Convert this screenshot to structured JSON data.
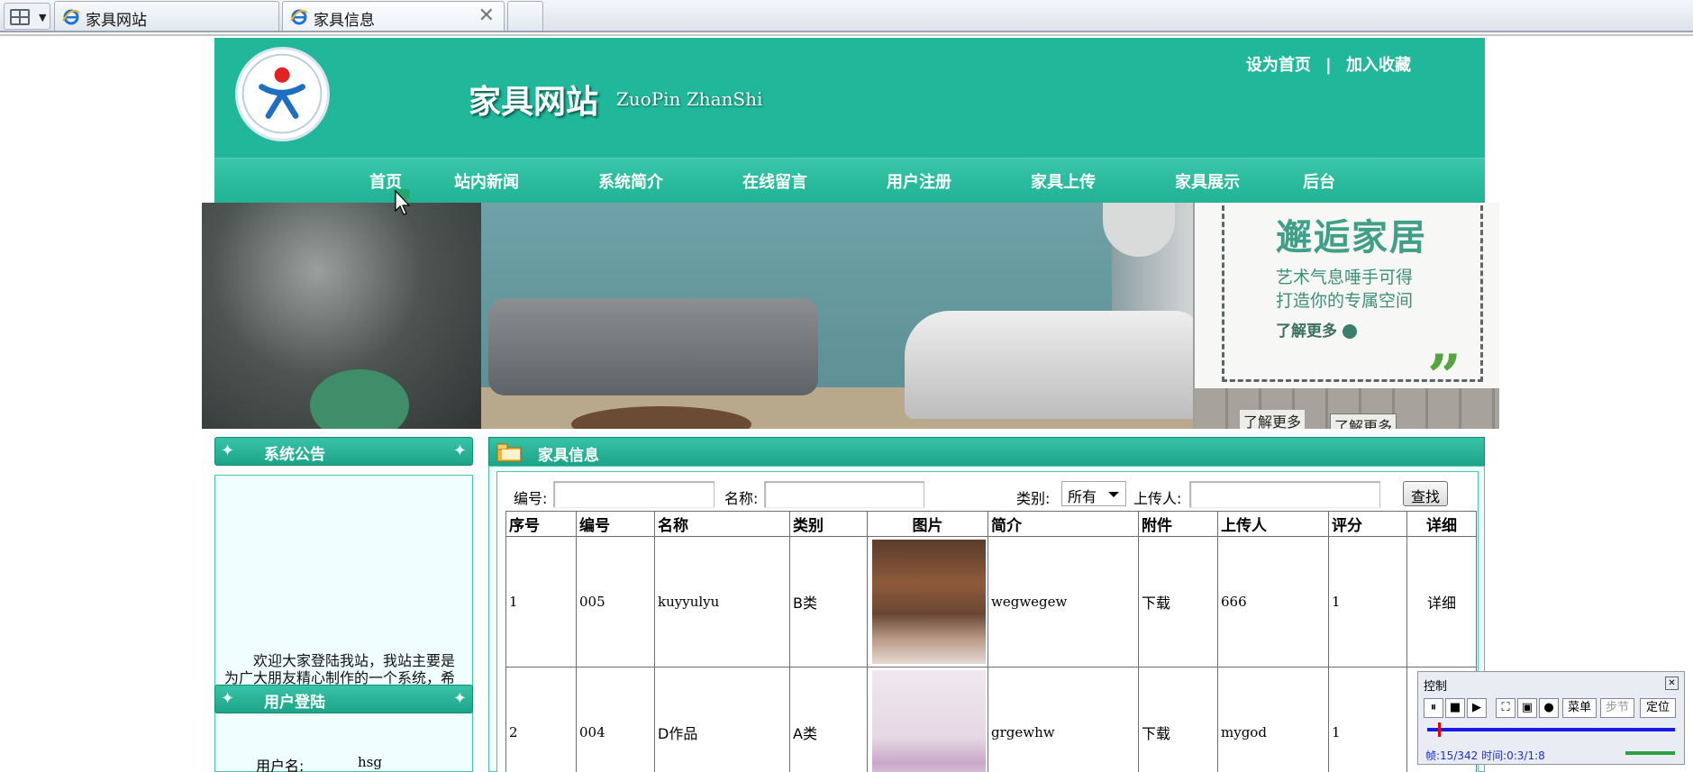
{
  "browser": {
    "tabs": [
      {
        "title": "家具网站",
        "active": false
      },
      {
        "title": "家具信息",
        "active": true
      }
    ],
    "close_glyph": "✕"
  },
  "header": {
    "title": "家具网站",
    "subtitle": "ZuoPin ZhanShi",
    "link_home": "设为首页",
    "link_sep": "|",
    "link_fav": "加入收藏"
  },
  "nav": [
    "首页",
    "站内新闻",
    "系统简介",
    "在线留言",
    "用户注册",
    "家具上传",
    "家具展示",
    "后台"
  ],
  "banner": {
    "headline": "邂逅家居",
    "line1": "艺术气息唾手可得",
    "line2": "打造你的专属空间",
    "more": "了解更多",
    "more_again": "了解更多",
    "more_clip": "了解更多"
  },
  "sidebar": {
    "notice_title": "系统公告",
    "notice_text": "欢迎大家登陆我站，我站主要是为广大朋友精心制作的一个系统，希望大家能够在我站获得一个",
    "login_title": "用户登陆",
    "login_label": "用户名:",
    "login_user": "hsg"
  },
  "content": {
    "title": "家具信息",
    "search": {
      "label_code": "编号:",
      "label_name": "名称:",
      "label_category": "类别:",
      "category_value": "所有",
      "label_uploader": "上传人:",
      "button": "查找"
    },
    "columns": [
      "序号",
      "编号",
      "名称",
      "类别",
      "图片",
      "简介",
      "附件",
      "上传人",
      "评分",
      "详细"
    ],
    "rows": [
      {
        "idx": "1",
        "code": "005",
        "name": "kuyyulyu",
        "category": "B类",
        "intro": "wegwegew",
        "attachment": "下载",
        "uploader": "666",
        "score": "1",
        "detail": "详细"
      },
      {
        "idx": "2",
        "code": "004",
        "name": "D作品",
        "category": "A类",
        "intro": "grgewhw",
        "attachment": "下载",
        "uploader": "mygod",
        "score": "1",
        "detail": ""
      }
    ]
  },
  "control": {
    "title": "控制",
    "menu": "菜单",
    "step": "步节",
    "locate": "定位",
    "status": "帧:15/342 时间:0:3/1:8",
    "progress_fraction": 0.044
  },
  "colors": {
    "primary": "#21b79a",
    "panel_bg": "#f0fefe",
    "border": "#45c7ad"
  }
}
